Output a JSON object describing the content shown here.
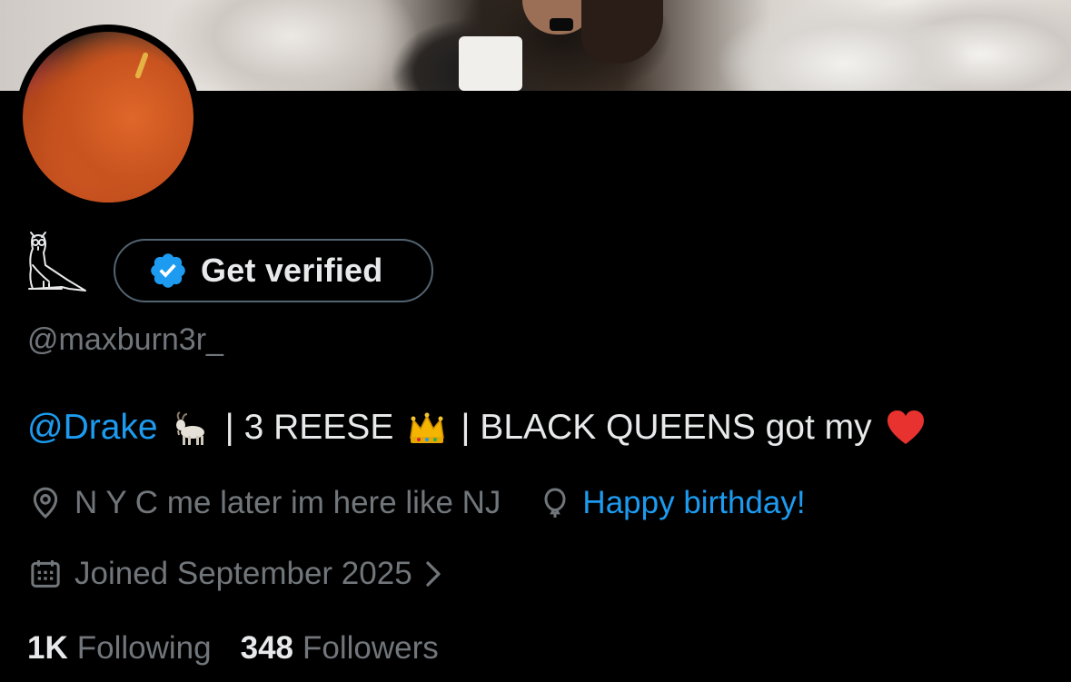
{
  "profile": {
    "verify_button": "Get verified",
    "handle": "@maxburn3r_",
    "bio": {
      "mention": "@Drake",
      "part2": "| 3 REESE",
      "part3": "| BLACK QUEENS got my",
      "emojis": [
        "goat-emoji",
        "crown-emoji",
        "red-heart-emoji"
      ]
    },
    "location": "N Y C me later im here like NJ",
    "birthday": "Happy birthday!",
    "joined": "Joined September 2025",
    "following_count": "1K",
    "following_label": "Following",
    "followers_count": "348",
    "followers_label": "Followers"
  },
  "colors": {
    "background": "#000000",
    "text": "#e7e9ea",
    "secondary": "#71767b",
    "accent": "#1d9bf0",
    "border": "#536471"
  },
  "icons": [
    "ovo-owl-icon",
    "verified-badge-icon",
    "location-pin-icon",
    "balloon-icon",
    "calendar-icon",
    "chevron-right-icon"
  ]
}
